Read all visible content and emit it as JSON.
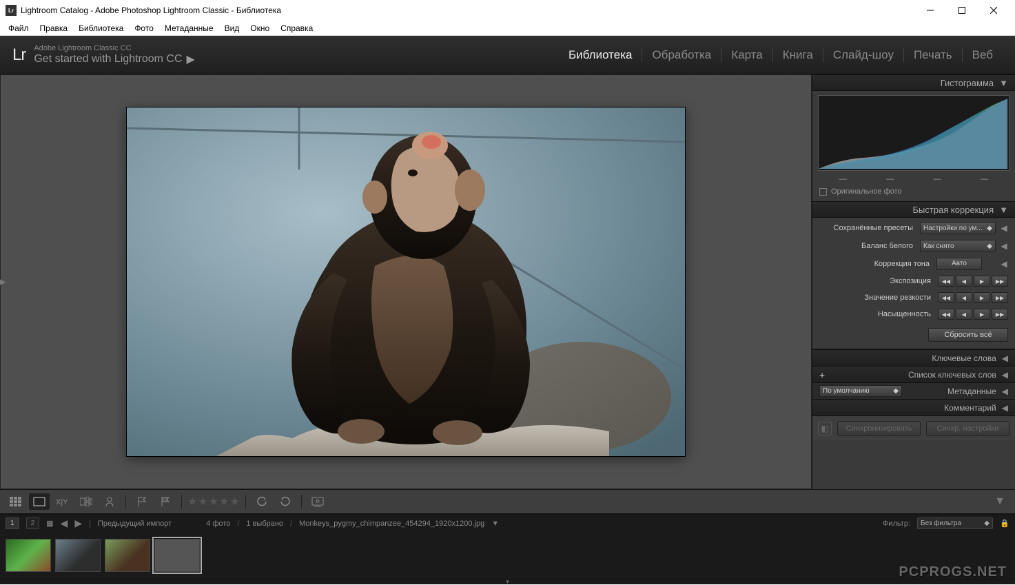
{
  "title": "Lightroom Catalog - Adobe Photoshop Lightroom Classic - Библиотека",
  "menu": [
    "Файл",
    "Правка",
    "Библиотека",
    "Фото",
    "Метаданные",
    "Вид",
    "Окно",
    "Справка"
  ],
  "header": {
    "logo": "Lr",
    "line1": "Adobe Lightroom Classic CC",
    "line2": "Get started with Lightroom CC"
  },
  "modules": [
    {
      "label": "Библиотека",
      "active": true
    },
    {
      "label": "Обработка",
      "active": false
    },
    {
      "label": "Карта",
      "active": false
    },
    {
      "label": "Книга",
      "active": false
    },
    {
      "label": "Слайд-шоу",
      "active": false
    },
    {
      "label": "Печать",
      "active": false
    },
    {
      "label": "Веб",
      "active": false
    }
  ],
  "panels": {
    "histogram_title": "Гистограмма",
    "original_photo": "Оригинальное фото",
    "quick_corr_title": "Быстрая коррекция",
    "saved_presets": "Сохранённые пресеты",
    "saved_presets_val": "Настройки по ум...",
    "white_balance": "Баланс белого",
    "white_balance_val": "Как снято",
    "tone_corr": "Коррекция тона",
    "auto": "Авто",
    "exposure": "Экспозиция",
    "sharpness": "Значение резкости",
    "saturation": "Насыщенность",
    "reset_all": "Сбросить всё",
    "keywords": "Ключевые слова",
    "keyword_list": "Список ключевых слов",
    "metadata": "Метаданные",
    "metadata_sel": "По умолчанию",
    "comment": "Комментарий",
    "sync": "Синхронизировать",
    "sync_settings": "Синхр. настройки"
  },
  "filmstrip": {
    "prev_import": "Предыдущий импорт",
    "count": "4 фото",
    "selected": "1 выбрано",
    "filename": "Monkeys_pygmy_chimpanzee_454294_1920x1200.jpg",
    "filter_label": "Фильтр:",
    "filter_val": "Без фильтра",
    "monitor1": "1",
    "monitor2": "2"
  },
  "watermark": "PCPROGS.NET"
}
